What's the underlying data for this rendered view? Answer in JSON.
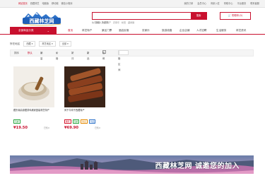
{
  "topbar": {
    "left": [
      "网站首页",
      "西藏林芝",
      "电脑版",
      "移动端",
      "微信小程序"
    ],
    "right": [
      "我的订单",
      "会员中心",
      "商家入驻",
      "帮助中心",
      "平台服务",
      "联系客服"
    ]
  },
  "search": {
    "placeholder": "请输入关键词",
    "button": "搜索",
    "hot": [
      "热门搜索",
      "林芝特产",
      "农家乐",
      "松茸",
      "藏香猪"
    ]
  },
  "cart": {
    "label": "购物车(0)"
  },
  "nav": {
    "category": "全部商品分类",
    "items": [
      "首页",
      "林芝特产",
      "景区门票",
      "酒店民宿",
      "农家乐",
      "旅游线路",
      "企业店铺",
      "人才招聘",
      "生活服务",
      "林芝资讯"
    ]
  },
  "filters": {
    "label": "所在地区",
    "province": "西藏",
    "city": "林芝地区",
    "district": "全部"
  },
  "sort": {
    "label": "排序",
    "items": [
      "默认",
      "销量",
      "价格",
      "好评",
      "新品"
    ],
    "free_shipping": "包邮",
    "price_label": "价格区间"
  },
  "products": [
    {
      "title": "藏东南高原藏茶鸡酱家庭装林芝特产",
      "tags": [
        "包邮"
      ],
      "price": "¥19.50",
      "sold": "已售0"
    },
    {
      "title": "风干牛肉干西藏特产",
      "tags": [
        "推荐",
        "包邮",
        "热卖",
        "新品"
      ],
      "price": "¥69.90",
      "sold": "已售0"
    }
  ],
  "banner": {
    "text": "西藏林芝网  诚邀您的加入"
  },
  "colors": {
    "brand": "#c8102e"
  }
}
